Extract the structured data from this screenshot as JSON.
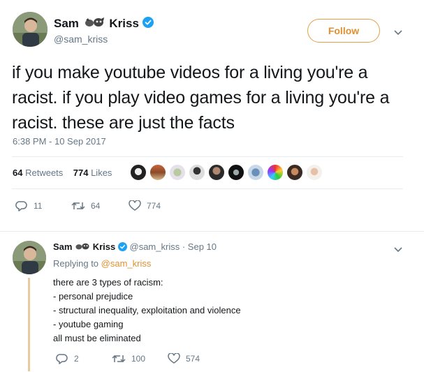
{
  "tweet": {
    "author_name": "Sam",
    "author_name_suffix": "Kriss",
    "author_handle": "@sam_kriss",
    "follow_label": "Follow",
    "text": "if you make youtube videos for a living you're a racist. if you play video games for a living you're a racist. these are just the facts",
    "timestamp": "6:38 PM - 10 Sep 2017",
    "retweets_count": "64",
    "retweets_label": "Retweets",
    "likes_count": "774",
    "likes_label": "Likes",
    "reply_count": "11",
    "retweet_action_count": "64",
    "like_action_count": "774"
  },
  "reply": {
    "author_name": "Sam",
    "author_name_suffix": "Kriss",
    "author_handle": "@sam_kriss",
    "dot": "·",
    "date": "Sep 10",
    "replying_prefix": "Replying to",
    "replying_to": "@sam_kriss",
    "lines": [
      "there are 3 types of racism:",
      "- personal prejudice",
      "- structural inequality, exploitation and violence",
      "- youtube gaming",
      "all must be eliminated"
    ],
    "reply_count": "2",
    "retweet_count": "100",
    "like_count": "574"
  },
  "colors": {
    "accent": "#e09030",
    "verified": "#1da1f2",
    "muted": "#657786",
    "thread": "#e8c9a0"
  }
}
